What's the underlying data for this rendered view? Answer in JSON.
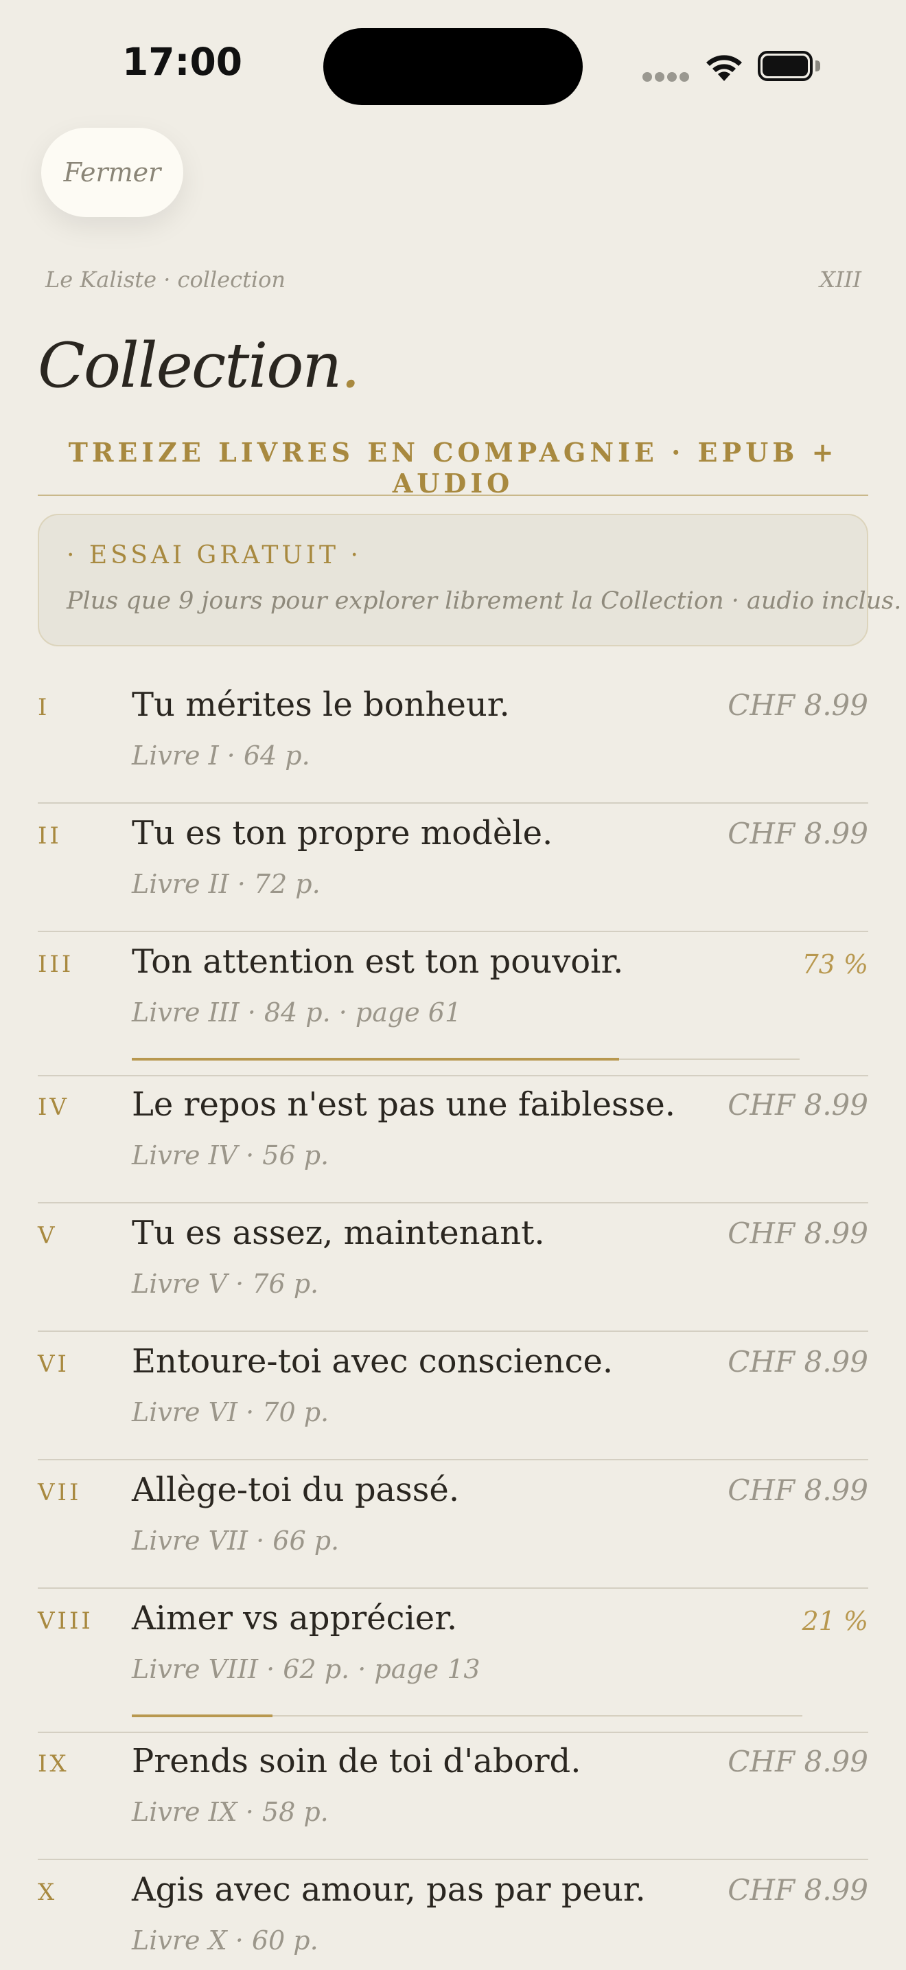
{
  "status_bar": {
    "time": "17:00",
    "signal_icon": "cellular-signal-icon",
    "wifi_icon": "wifi-icon",
    "battery_icon": "battery-icon"
  },
  "close_button": {
    "label": "Fermer"
  },
  "header": {
    "brand": "Le Kaliste · collection",
    "volume": "XIII",
    "title": "Collection",
    "title_dot": ".",
    "subtitle": "TREIZE LIVRES EN COMPAGNIE · EPUB + AUDIO"
  },
  "trial": {
    "title": "· ESSAI GRATUIT ·",
    "text": "Plus que 9 jours pour explorer librement la Collection · audio inclus."
  },
  "colors": {
    "background": "#f0ede5",
    "accent_gold": "#a8893f",
    "text_dark": "#2a2620",
    "text_muted": "#9b968a"
  },
  "books": [
    {
      "numeral": "I",
      "title": "Tu mérites le bonheur.",
      "meta": "Livre I · 64 p.",
      "price": "CHF 8.99"
    },
    {
      "numeral": "II",
      "title": "Tu es ton propre modèle.",
      "meta": "Livre II · 72 p.",
      "price": "CHF 8.99"
    },
    {
      "numeral": "III",
      "title": "Ton attention est ton pouvoir.",
      "meta": "Livre III · 84 p. · page 61",
      "price": "73 %",
      "progress": 0.73
    },
    {
      "numeral": "IV",
      "title": "Le repos n'est pas une faiblesse.",
      "meta": "Livre IV · 56 p.",
      "price": "CHF 8.99"
    },
    {
      "numeral": "V",
      "title": "Tu es assez, maintenant.",
      "meta": "Livre V · 76 p.",
      "price": "CHF 8.99"
    },
    {
      "numeral": "VI",
      "title": "Entoure-toi avec conscience.",
      "meta": "Livre VI · 70 p.",
      "price": "CHF 8.99"
    },
    {
      "numeral": "VII",
      "title": "Allège-toi du passé.",
      "meta": "Livre VII · 66 p.",
      "price": "CHF 8.99"
    },
    {
      "numeral": "VIII",
      "title": "Aimer vs apprécier.",
      "meta": "Livre VIII · 62 p. · page 13",
      "price": "21 %",
      "progress": 0.21
    },
    {
      "numeral": "IX",
      "title": "Prends soin de toi d'abord.",
      "meta": "Livre IX · 58 p.",
      "price": "CHF 8.99"
    },
    {
      "numeral": "X",
      "title": "Agis avec amour, pas par peur.",
      "meta": "Livre X · 60 p.",
      "price": "CHF 8.99"
    }
  ]
}
